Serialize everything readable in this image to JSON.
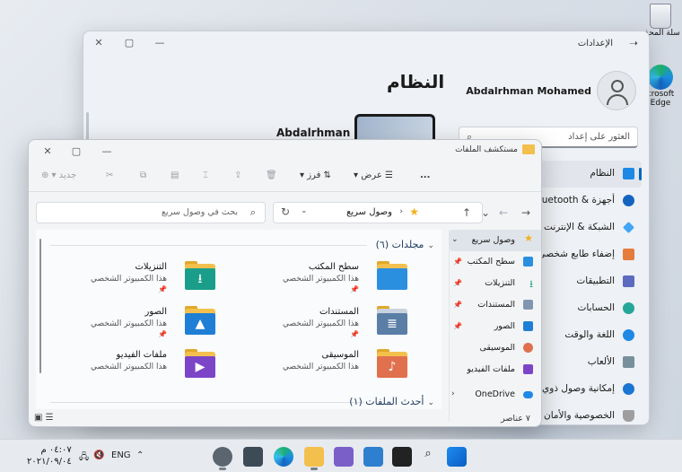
{
  "colors": {
    "accent": "#0067c0",
    "folder": "#f3c04d",
    "star": "#f2b01e"
  },
  "desktop": {
    "recycle_bin_label": "سلة المحذو",
    "edge_label": "crosoft Edge"
  },
  "settings": {
    "window_title": "الإعدادات",
    "page_title": "النظام",
    "user_name": "Abdalrhman Mohamed",
    "device_name": "Abdalrhman",
    "search_placeholder": "العثور على إعداد",
    "nav": [
      {
        "label": "النظام",
        "icon": "system-icon",
        "color": "#1e88e5"
      },
      {
        "label": "Bluetooth & أجهزة",
        "icon": "bluetooth-icon",
        "color": "#1565c0"
      },
      {
        "label": "الشبكة & الإنترنت",
        "icon": "wifi-icon",
        "color": "#42a5f5"
      },
      {
        "label": "إضفاء طابع شخصي",
        "icon": "brush-icon",
        "color": "#e57c3c"
      },
      {
        "label": "التطبيقات",
        "icon": "apps-icon",
        "color": "#5c6bc0"
      },
      {
        "label": "الحسابات",
        "icon": "accounts-icon",
        "color": "#26a69a"
      },
      {
        "label": "اللغة والوقت",
        "icon": "globe-clock-icon",
        "color": "#1e88e5"
      },
      {
        "label": "الألعاب",
        "icon": "gamepad-icon",
        "color": "#78909c"
      },
      {
        "label": "إمكانية وصول ذوي",
        "icon": "accessibility-icon",
        "color": "#1976d2"
      },
      {
        "label": "الخصوصية والأمان",
        "icon": "shield-icon",
        "color": "#9e9e9e"
      }
    ]
  },
  "explorer": {
    "window_title": "مستكشف الملفات",
    "toolbar": {
      "new_label": "جديد",
      "sort_label": "فرز",
      "view_label": "عرض",
      "more_label": "..."
    },
    "address_path": "وصول سريع",
    "search_placeholder": "بحث في وصول سريع",
    "folders_header": "مجلدات (٦)",
    "recent_header": "أحدث الملفات (١)",
    "folders": [
      {
        "name": "سطح المكتب",
        "location": "هذا الكمبيوتر الشخصي",
        "icon": "desktop-folder-icon",
        "glyph": "",
        "color": "#2b8fe0"
      },
      {
        "name": "التنزيلات",
        "location": "هذا الكمبيوتر الشخصي",
        "icon": "downloads-folder-icon",
        "glyph": "⭳",
        "color": "#1a9e8a"
      },
      {
        "name": "المستندات",
        "location": "هذا الكمبيوتر الشخصي",
        "icon": "documents-folder-icon",
        "glyph": "≣",
        "color": "#5a7ea6"
      },
      {
        "name": "الصور",
        "location": "هذا الكمبيوتر الشخصي",
        "icon": "pictures-folder-icon",
        "glyph": "▲",
        "color": "#1f7fd6"
      },
      {
        "name": "الموسيقى",
        "location": "هذا الكمبيوتر الشخصي",
        "icon": "music-folder-icon",
        "glyph": "♪",
        "color": "#e0704e"
      },
      {
        "name": "ملفات الفيديو",
        "location": "هذا الكمبيوتر الشخصي",
        "icon": "videos-folder-icon",
        "glyph": "▶",
        "color": "#7c45c8"
      }
    ],
    "sidebar": [
      {
        "label": "وصول سريع",
        "icon": "star-icon",
        "color": "#f2b01e"
      },
      {
        "label": "سطح المكتب",
        "icon": "desktop-icon",
        "color": "#2b8fe0"
      },
      {
        "label": "التنزيلات",
        "icon": "download-icon",
        "color": "#1a9e8a"
      },
      {
        "label": "المستندات",
        "icon": "document-icon",
        "color": "#8096b0"
      },
      {
        "label": "الصور",
        "icon": "picture-icon",
        "color": "#1f7fd6"
      },
      {
        "label": "الموسيقى",
        "icon": "music-icon",
        "color": "#e0704e"
      },
      {
        "label": "ملفات الفيديو",
        "icon": "video-icon",
        "color": "#7c45c8"
      },
      {
        "label": "OneDrive",
        "icon": "cloud-icon",
        "color": "#1e88e5"
      }
    ],
    "item_count": "٧ عناصر"
  },
  "taskbar": {
    "time": "٠٤:٠٧ م",
    "date": "٢٠٢١/٠٩/٠٤",
    "language": "ENG",
    "apps": [
      "settings-icon",
      "store-icon",
      "edge-icon",
      "explorer-icon",
      "terminal-icon",
      "chat-icon",
      "widgets-icon",
      "search-icon",
      "start-icon"
    ]
  }
}
